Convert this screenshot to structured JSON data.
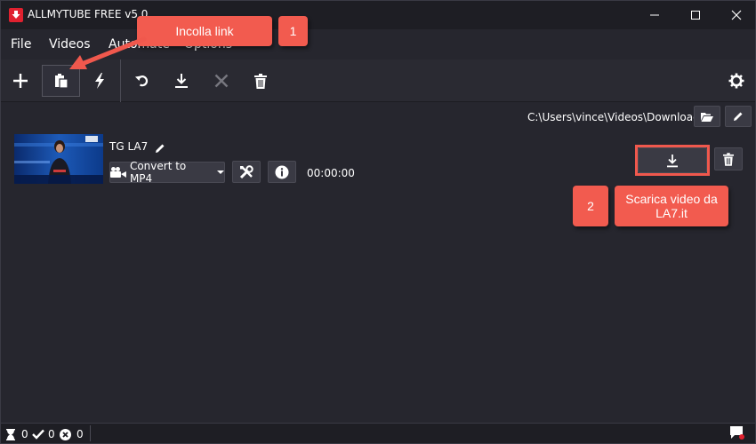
{
  "window": {
    "title": "ALLMYTUBE FREE v5.0"
  },
  "menu": {
    "file": "File",
    "videos": "Videos",
    "automate": "Automate",
    "options": "Options"
  },
  "output": {
    "path": "C:\\Users\\vince\\Videos\\Downloads"
  },
  "item": {
    "title": "TG LA7",
    "convert_label": "Convert to MP4",
    "duration": "00:00:00"
  },
  "annotations": {
    "step1_number": "1",
    "step1_label": "Incolla link",
    "step2_number": "2",
    "step2_label": "Scarica video da LA7.it"
  },
  "status": {
    "pending": "0",
    "completed": "0",
    "failed": "0"
  },
  "colors": {
    "accent": "#f25b4f",
    "logo": "#e0212f",
    "background": "#26262e"
  }
}
